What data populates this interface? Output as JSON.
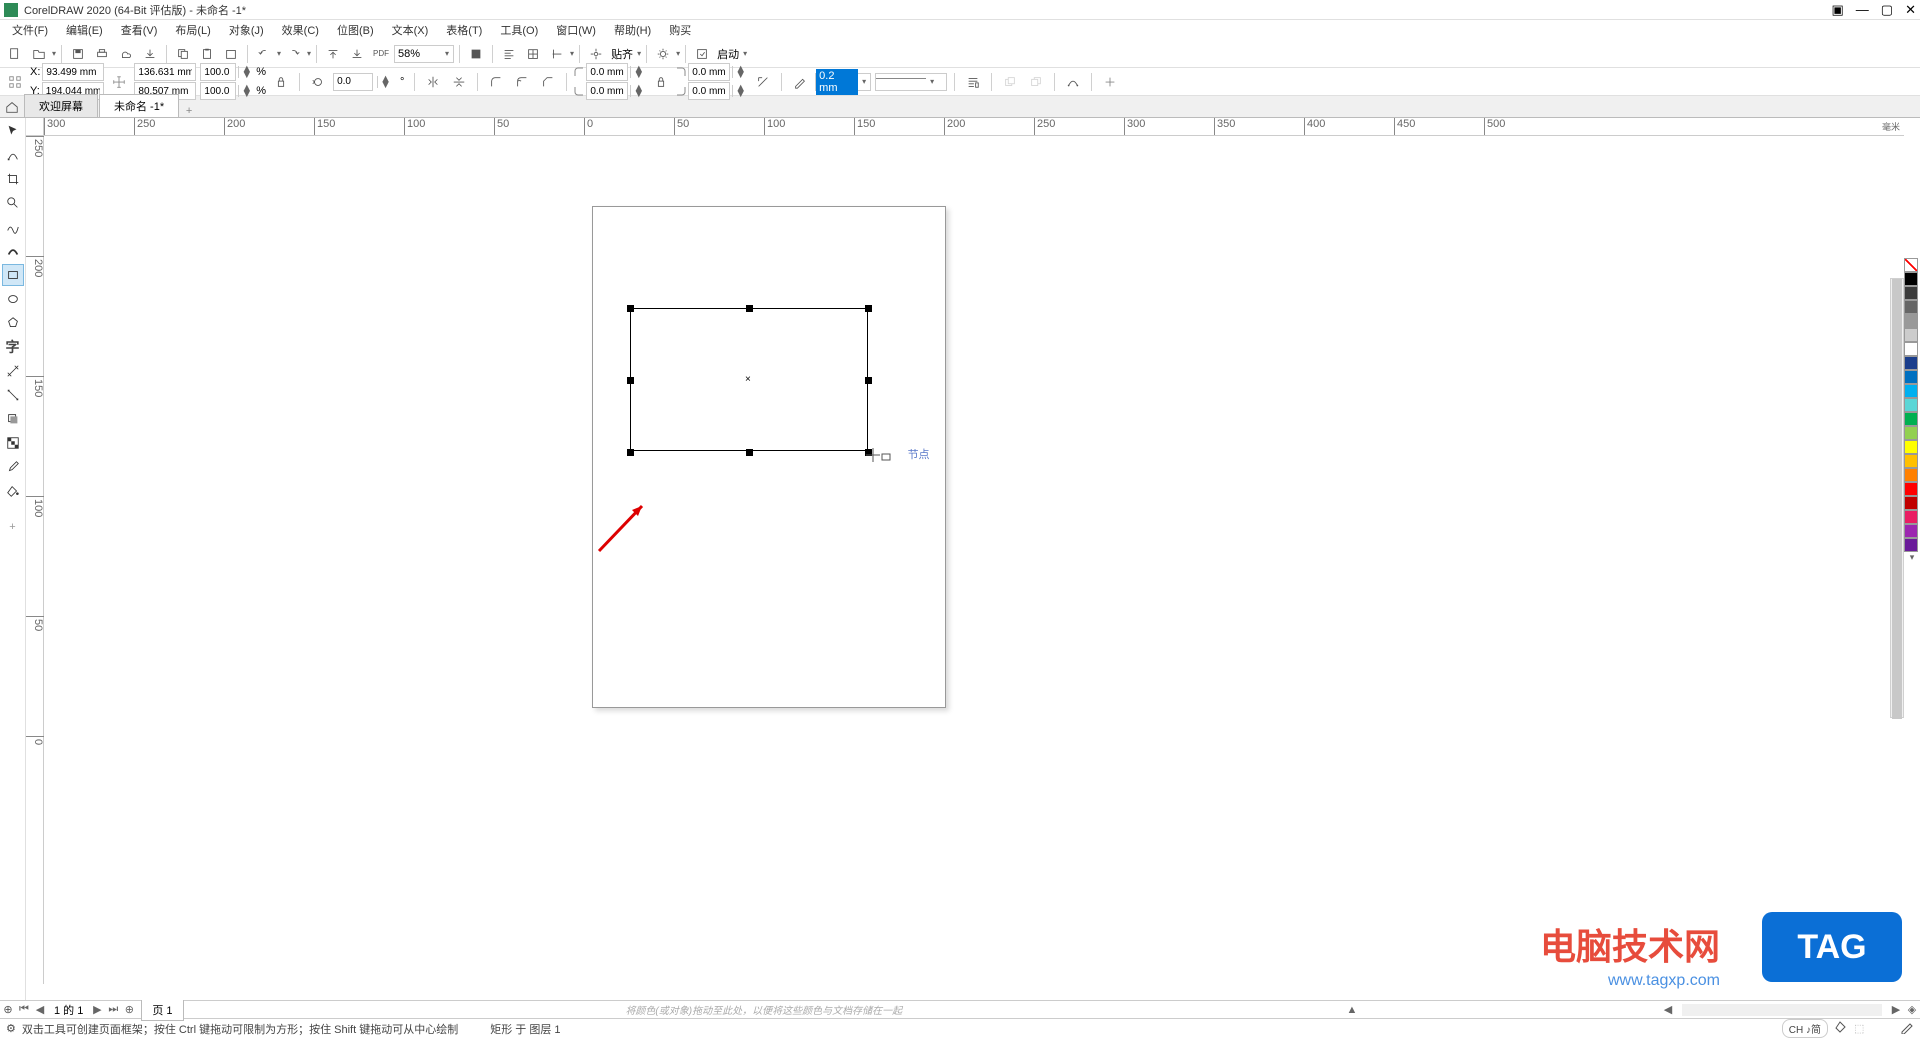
{
  "title": "CorelDRAW 2020 (64-Bit 评估版) - 未命名 -1*",
  "menu": [
    "文件(F)",
    "编辑(E)",
    "查看(V)",
    "布局(L)",
    "对象(J)",
    "效果(C)",
    "位图(B)",
    "文本(X)",
    "表格(T)",
    "工具(O)",
    "窗口(W)",
    "帮助(H)",
    "购买"
  ],
  "toolbar1": {
    "zoom": "58%",
    "snap": "贴齐",
    "launch": "启动"
  },
  "props": {
    "x_label": "X:",
    "y_label": "Y:",
    "x": "93.499 mm",
    "y": "194.044 mm",
    "w": "136.631 mm",
    "h": "80.507 mm",
    "scale_x": "100.0",
    "scale_y": "100.0",
    "percent": "%",
    "rotation": "0.0",
    "deg": "°",
    "corner1a": "0.0 mm",
    "corner1b": "0.0 mm",
    "corner2a": "0.0 mm",
    "corner2b": "0.0 mm",
    "outline_width": "0.2 mm"
  },
  "tabs": {
    "welcome": "欢迎屏幕",
    "doc": "未命名 -1*"
  },
  "ruler": {
    "unit": "毫米",
    "h_ticks": [
      -300,
      -250,
      -200,
      -150,
      -100,
      -50,
      0,
      50,
      100,
      150,
      200,
      250,
      300,
      350,
      400,
      450,
      500
    ],
    "v_ticks": [
      250,
      200,
      150,
      100,
      50,
      0
    ]
  },
  "canvas": {
    "node_hint": "节点"
  },
  "color_swatches": [
    "#000000",
    "#3b3b3b",
    "#666666",
    "#999999",
    "#cccccc",
    "#ffffff",
    "#1b3e8c",
    "#0070c0",
    "#00b0f0",
    "#5bd6d6",
    "#00b050",
    "#92d050",
    "#ffff00",
    "#ffc000",
    "#ff8000",
    "#ff0000",
    "#c00000",
    "#e91e63",
    "#9c27b0",
    "#6a1b9a"
  ],
  "pagenav": {
    "info": "1 的 1",
    "page_tab": "页 1",
    "drop_hint": "将颜色(或对象)拖动至此处，以便将这些颜色与文档存储在一起"
  },
  "status": {
    "hint": "双击工具可创建页面框架；按住 Ctrl 键拖动可限制为方形；按住 Shift 键拖动可从中心绘制",
    "object": "矩形 于 图层 1",
    "lang": "CH ♪简"
  },
  "watermarks": {
    "site_cn": "电脑技术网",
    "tag": "TAG",
    "url": "www.tagxp.com"
  }
}
